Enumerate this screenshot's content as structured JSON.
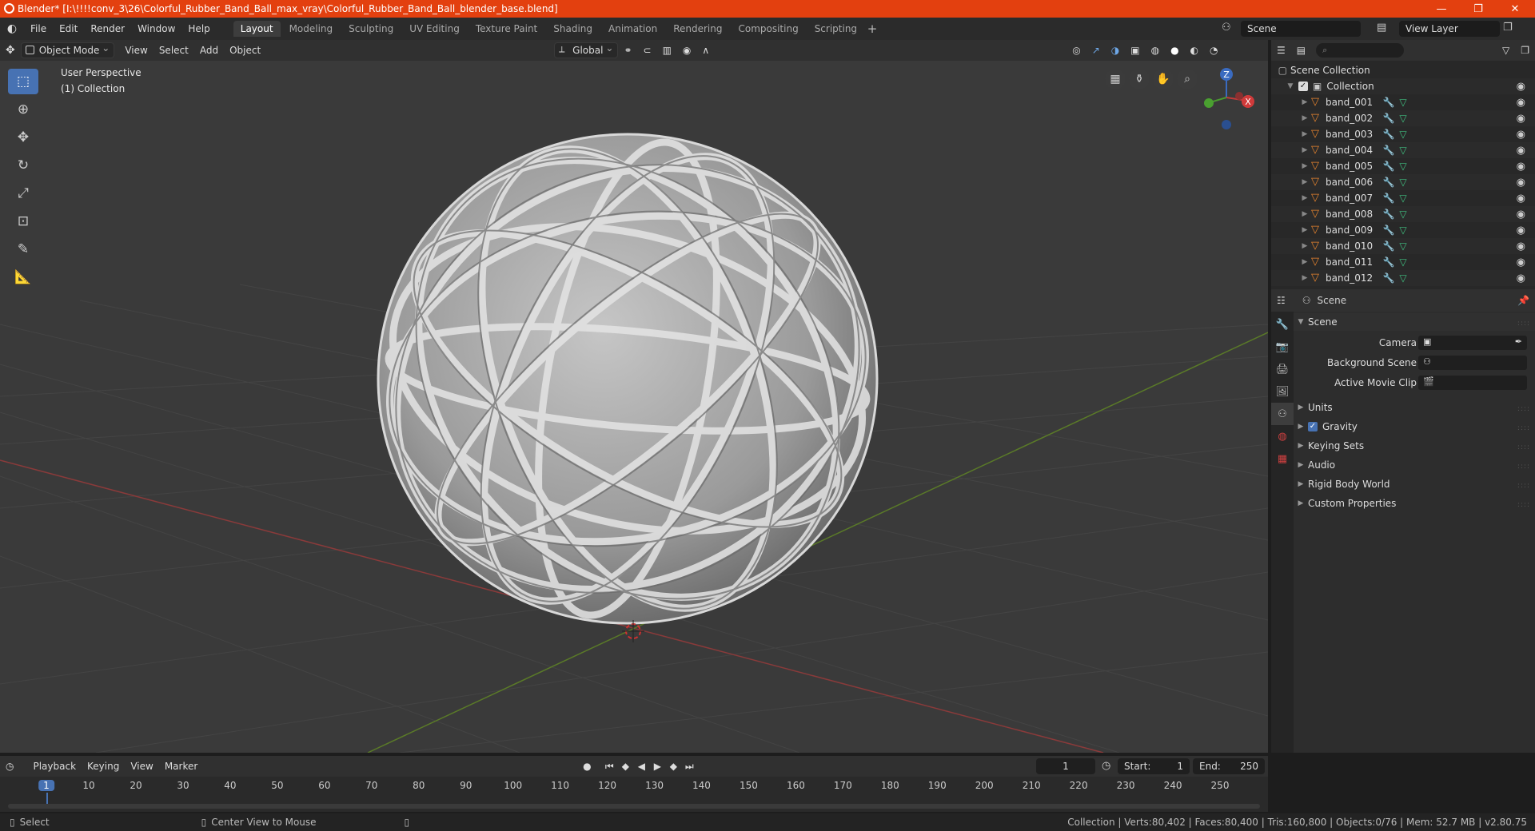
{
  "window": {
    "title": "Blender* [I:\\!!!!conv_3\\26\\Colorful_Rubber_Band_Ball_max_vray\\Colorful_Rubber_Band_Ball_blender_base.blend]",
    "minimize": "—",
    "maximize": "❐",
    "close": "✕"
  },
  "menu": {
    "items": [
      "File",
      "Edit",
      "Render",
      "Window",
      "Help"
    ]
  },
  "workspaces": [
    "Layout",
    "Modeling",
    "Sculpting",
    "UV Editing",
    "Texture Paint",
    "Shading",
    "Animation",
    "Rendering",
    "Compositing",
    "Scripting"
  ],
  "scene_field": "Scene",
  "view_layer_field": "View Layer",
  "viewport_header": {
    "mode": "Object Mode",
    "view": "View",
    "select": "Select",
    "add": "Add",
    "object": "Object",
    "orientation": "Global"
  },
  "viewport": {
    "perspective": "User Perspective",
    "collection": "(1) Collection",
    "gizmo_z": "Z",
    "gizmo_x": "X"
  },
  "outliner": {
    "scene_collection": "Scene Collection",
    "collection": "Collection",
    "objects": [
      "band_001",
      "band_002",
      "band_003",
      "band_004",
      "band_005",
      "band_006",
      "band_007",
      "band_008",
      "band_009",
      "band_010",
      "band_011",
      "band_012"
    ]
  },
  "properties": {
    "context": "Scene",
    "panel_scene": "Scene",
    "camera_label": "Camera",
    "background_scene_label": "Background Scene",
    "active_movie_clip_label": "Active Movie Clip",
    "panels": [
      "Units",
      "Gravity",
      "Keying Sets",
      "Audio",
      "Rigid Body World",
      "Custom Properties"
    ]
  },
  "timeline": {
    "playback": "Playback",
    "keying": "Keying",
    "view": "View",
    "marker": "Marker",
    "current_frame": "1",
    "start_label": "Start:",
    "start": "1",
    "end_label": "End:",
    "end": "250",
    "ticks": [
      "1",
      "10",
      "20",
      "30",
      "40",
      "50",
      "60",
      "70",
      "80",
      "90",
      "100",
      "110",
      "120",
      "130",
      "140",
      "150",
      "160",
      "170",
      "180",
      "190",
      "200",
      "210",
      "220",
      "230",
      "240",
      "250"
    ]
  },
  "status": {
    "select": "Select",
    "center_view": "Center View to Mouse",
    "stats": "Collection | Verts:80,402 | Faces:80,400 | Tris:160,800 | Objects:0/76 | Mem: 52.7 MB | v2.80.75"
  },
  "colors": {
    "title_bar": "#e3400f",
    "accent": "#4772b3",
    "object_icon": "#e8852f",
    "axis_x": "#b04040",
    "axis_y": "#6a8a30"
  }
}
